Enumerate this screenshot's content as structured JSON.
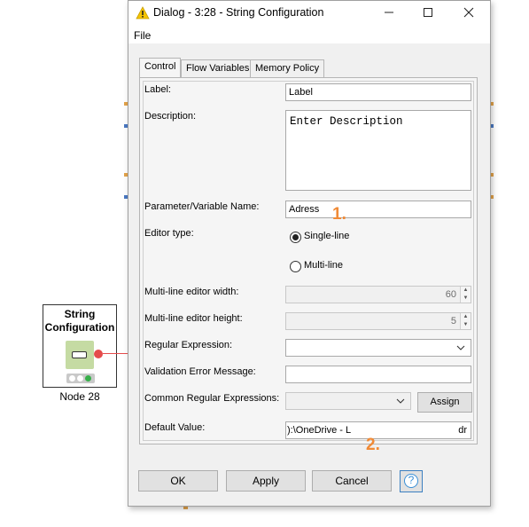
{
  "workflow": {
    "node_title": "String\nConfiguration",
    "node_title_line1": "String",
    "node_title_line2": "Configuration",
    "node_label": "Node 28"
  },
  "dialog": {
    "title": "Dialog - 3:28 - String Configuration",
    "menu_file": "File",
    "tabs": [
      {
        "label": "Control",
        "active": true
      },
      {
        "label": "Flow Variables",
        "active": false
      },
      {
        "label": "Memory Policy",
        "active": false
      }
    ],
    "form": {
      "label_label": "Label:",
      "label_value": "Label",
      "description_label": "Description:",
      "description_value": "Enter Description",
      "param_label": "Parameter/Variable Name:",
      "param_value": "Adress",
      "editor_type_label": "Editor type:",
      "editor_single": "Single-line",
      "editor_multi": "Multi-line",
      "editor_selected": "Single-line",
      "ml_width_label": "Multi-line editor width:",
      "ml_width_value": "60",
      "ml_height_label": "Multi-line editor height:",
      "ml_height_value": "5",
      "regex_label": "Regular Expression:",
      "regex_value": "",
      "validation_label": "Validation Error Message:",
      "validation_value": "",
      "common_regex_label": "Common Regular Expressions:",
      "common_regex_value": "",
      "assign_label": "Assign",
      "default_label": "Default Value:",
      "default_value_left": "):\\OneDrive - L",
      "default_value_right": "dr"
    },
    "buttons": {
      "ok": "OK",
      "apply": "Apply",
      "cancel": "Cancel",
      "help": "?"
    }
  },
  "annotations": {
    "one": "1.",
    "two": "2.",
    "color": "#f08a36"
  },
  "colors": {
    "node_icon_bg": "#c5dba3",
    "port_red": "#e54c4c",
    "status_green": "#37b04a",
    "help_blue": "#3a8fd6"
  }
}
